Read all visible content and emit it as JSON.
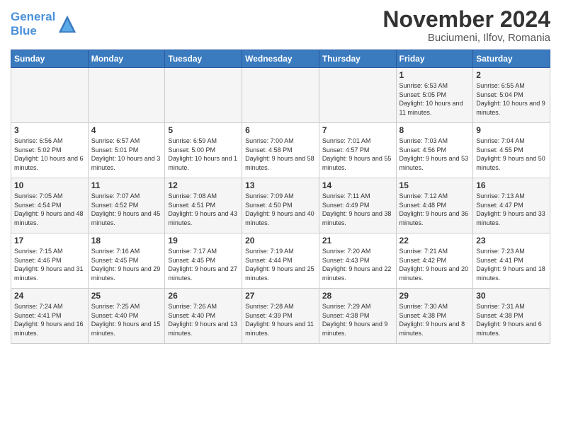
{
  "logo": {
    "line1": "General",
    "line2": "Blue"
  },
  "title": "November 2024",
  "location": "Buciumeni, Ilfov, Romania",
  "days_of_week": [
    "Sunday",
    "Monday",
    "Tuesday",
    "Wednesday",
    "Thursday",
    "Friday",
    "Saturday"
  ],
  "weeks": [
    [
      {
        "day": "",
        "info": ""
      },
      {
        "day": "",
        "info": ""
      },
      {
        "day": "",
        "info": ""
      },
      {
        "day": "",
        "info": ""
      },
      {
        "day": "",
        "info": ""
      },
      {
        "day": "1",
        "info": "Sunrise: 6:53 AM\nSunset: 5:05 PM\nDaylight: 10 hours and 11 minutes."
      },
      {
        "day": "2",
        "info": "Sunrise: 6:55 AM\nSunset: 5:04 PM\nDaylight: 10 hours and 9 minutes."
      }
    ],
    [
      {
        "day": "3",
        "info": "Sunrise: 6:56 AM\nSunset: 5:02 PM\nDaylight: 10 hours and 6 minutes."
      },
      {
        "day": "4",
        "info": "Sunrise: 6:57 AM\nSunset: 5:01 PM\nDaylight: 10 hours and 3 minutes."
      },
      {
        "day": "5",
        "info": "Sunrise: 6:59 AM\nSunset: 5:00 PM\nDaylight: 10 hours and 1 minute."
      },
      {
        "day": "6",
        "info": "Sunrise: 7:00 AM\nSunset: 4:58 PM\nDaylight: 9 hours and 58 minutes."
      },
      {
        "day": "7",
        "info": "Sunrise: 7:01 AM\nSunset: 4:57 PM\nDaylight: 9 hours and 55 minutes."
      },
      {
        "day": "8",
        "info": "Sunrise: 7:03 AM\nSunset: 4:56 PM\nDaylight: 9 hours and 53 minutes."
      },
      {
        "day": "9",
        "info": "Sunrise: 7:04 AM\nSunset: 4:55 PM\nDaylight: 9 hours and 50 minutes."
      }
    ],
    [
      {
        "day": "10",
        "info": "Sunrise: 7:05 AM\nSunset: 4:54 PM\nDaylight: 9 hours and 48 minutes."
      },
      {
        "day": "11",
        "info": "Sunrise: 7:07 AM\nSunset: 4:52 PM\nDaylight: 9 hours and 45 minutes."
      },
      {
        "day": "12",
        "info": "Sunrise: 7:08 AM\nSunset: 4:51 PM\nDaylight: 9 hours and 43 minutes."
      },
      {
        "day": "13",
        "info": "Sunrise: 7:09 AM\nSunset: 4:50 PM\nDaylight: 9 hours and 40 minutes."
      },
      {
        "day": "14",
        "info": "Sunrise: 7:11 AM\nSunset: 4:49 PM\nDaylight: 9 hours and 38 minutes."
      },
      {
        "day": "15",
        "info": "Sunrise: 7:12 AM\nSunset: 4:48 PM\nDaylight: 9 hours and 36 minutes."
      },
      {
        "day": "16",
        "info": "Sunrise: 7:13 AM\nSunset: 4:47 PM\nDaylight: 9 hours and 33 minutes."
      }
    ],
    [
      {
        "day": "17",
        "info": "Sunrise: 7:15 AM\nSunset: 4:46 PM\nDaylight: 9 hours and 31 minutes."
      },
      {
        "day": "18",
        "info": "Sunrise: 7:16 AM\nSunset: 4:45 PM\nDaylight: 9 hours and 29 minutes."
      },
      {
        "day": "19",
        "info": "Sunrise: 7:17 AM\nSunset: 4:45 PM\nDaylight: 9 hours and 27 minutes."
      },
      {
        "day": "20",
        "info": "Sunrise: 7:19 AM\nSunset: 4:44 PM\nDaylight: 9 hours and 25 minutes."
      },
      {
        "day": "21",
        "info": "Sunrise: 7:20 AM\nSunset: 4:43 PM\nDaylight: 9 hours and 22 minutes."
      },
      {
        "day": "22",
        "info": "Sunrise: 7:21 AM\nSunset: 4:42 PM\nDaylight: 9 hours and 20 minutes."
      },
      {
        "day": "23",
        "info": "Sunrise: 7:23 AM\nSunset: 4:41 PM\nDaylight: 9 hours and 18 minutes."
      }
    ],
    [
      {
        "day": "24",
        "info": "Sunrise: 7:24 AM\nSunset: 4:41 PM\nDaylight: 9 hours and 16 minutes."
      },
      {
        "day": "25",
        "info": "Sunrise: 7:25 AM\nSunset: 4:40 PM\nDaylight: 9 hours and 15 minutes."
      },
      {
        "day": "26",
        "info": "Sunrise: 7:26 AM\nSunset: 4:40 PM\nDaylight: 9 hours and 13 minutes."
      },
      {
        "day": "27",
        "info": "Sunrise: 7:28 AM\nSunset: 4:39 PM\nDaylight: 9 hours and 11 minutes."
      },
      {
        "day": "28",
        "info": "Sunrise: 7:29 AM\nSunset: 4:38 PM\nDaylight: 9 hours and 9 minutes."
      },
      {
        "day": "29",
        "info": "Sunrise: 7:30 AM\nSunset: 4:38 PM\nDaylight: 9 hours and 8 minutes."
      },
      {
        "day": "30",
        "info": "Sunrise: 7:31 AM\nSunset: 4:38 PM\nDaylight: 9 hours and 6 minutes."
      }
    ]
  ]
}
